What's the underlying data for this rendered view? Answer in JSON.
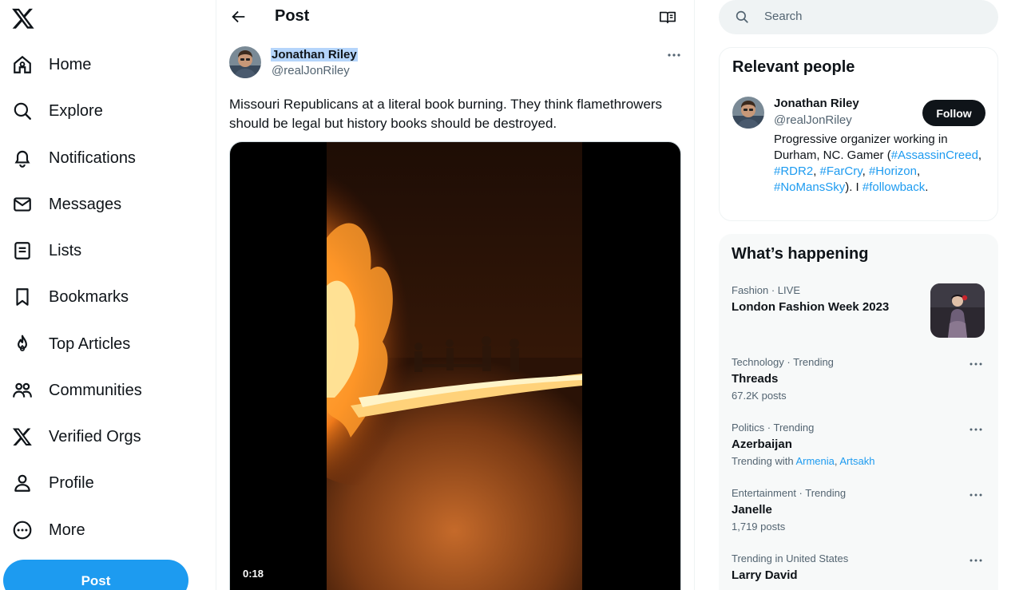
{
  "nav": {
    "logo_icon": "x-logo-icon",
    "items": [
      {
        "label": "Home",
        "icon": "home-icon"
      },
      {
        "label": "Explore",
        "icon": "search-icon"
      },
      {
        "label": "Notifications",
        "icon": "bell-icon"
      },
      {
        "label": "Messages",
        "icon": "envelope-icon"
      },
      {
        "label": "Lists",
        "icon": "list-icon"
      },
      {
        "label": "Bookmarks",
        "icon": "bookmark-icon"
      },
      {
        "label": "Top Articles",
        "icon": "flame-icon"
      },
      {
        "label": "Communities",
        "icon": "people-icon"
      },
      {
        "label": "Verified Orgs",
        "icon": "x-logo-icon"
      },
      {
        "label": "Profile",
        "icon": "person-icon"
      },
      {
        "label": "More",
        "icon": "more-circle-icon"
      }
    ],
    "post_label": "Post"
  },
  "header": {
    "title": "Post",
    "back_icon": "arrow-left-icon",
    "reader_icon": "book-icon"
  },
  "post": {
    "author_name": "Jonathan Riley",
    "author_handle": "@realJonRiley",
    "text": "Missouri Republicans at a literal book burning. They think flamethrowers should be legal but history books should be destroyed.",
    "video_duration": "0:18",
    "more_icon": "more-dots-icon"
  },
  "search": {
    "placeholder": "Search",
    "icon": "search-icon"
  },
  "relevant": {
    "title": "Relevant people",
    "name": "Jonathan Riley",
    "handle": "@realJonRiley",
    "follow_label": "Follow",
    "bio_prefix": "Progressive organizer working in Durham, NC. Gamer (",
    "bio_tags": [
      "#AssassinCreed",
      "#RDR2",
      "#FarCry",
      "#Horizon",
      "#NoMansSky",
      "#followback"
    ],
    "bio_sep": ", ",
    "bio_mid": "). I ",
    "bio_end": "."
  },
  "happening": {
    "title": "What’s happening",
    "trends": [
      {
        "meta": "Fashion · LIVE",
        "name": "London Fashion Week 2023"
      },
      {
        "meta": "Technology · Trending",
        "name": "Threads",
        "sub": "67.2K posts"
      },
      {
        "meta": "Politics · Trending",
        "name": "Azerbaijan",
        "sub_prefix": "Trending with ",
        "links": [
          "Armenia",
          "Artsakh"
        ],
        "sep": ", "
      },
      {
        "meta": "Entertainment · Trending",
        "name": "Janelle",
        "sub": "1,719 posts"
      },
      {
        "meta": "Trending in United States",
        "name": "Larry David"
      }
    ]
  },
  "colors": {
    "accent": "#1d9bf0",
    "text": "#0f1419",
    "muted": "#536471",
    "selection": "#b5d5fb"
  }
}
